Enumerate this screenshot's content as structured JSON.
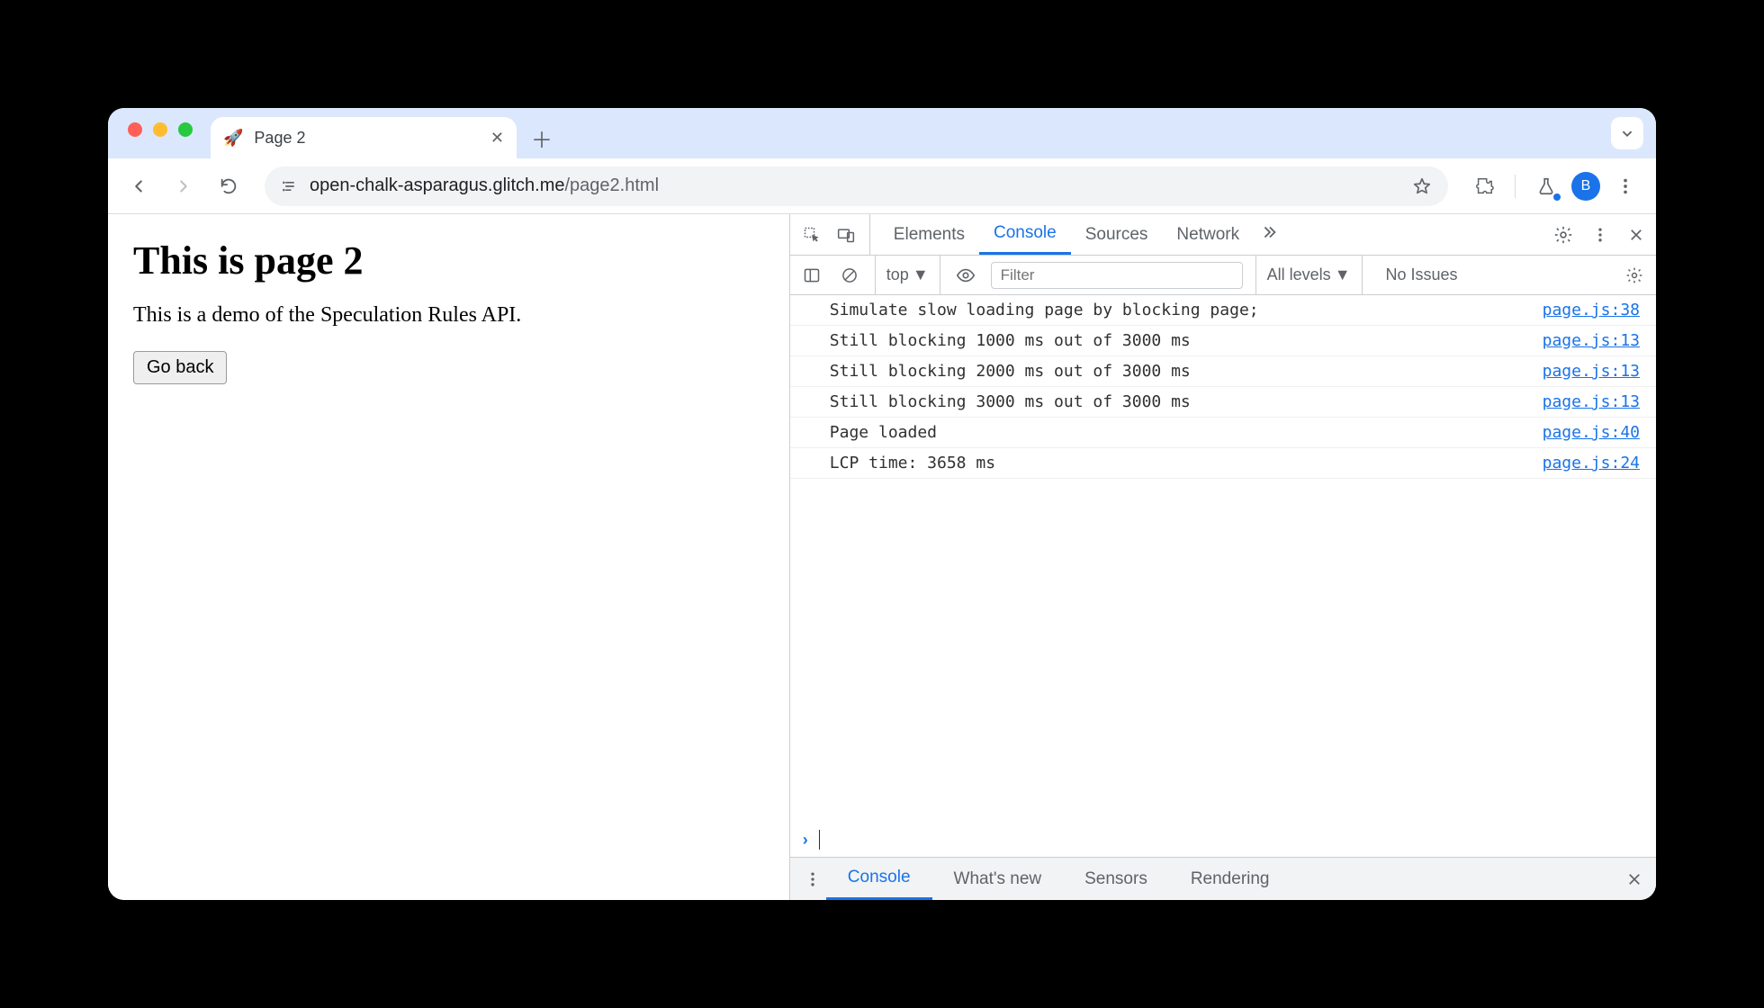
{
  "browser": {
    "tab_favicon": "🚀",
    "tab_title": "Page 2",
    "url_host": "open-chalk-asparagus.glitch.me",
    "url_path": "/page2.html",
    "avatar_letter": "B"
  },
  "page": {
    "heading": "This is page 2",
    "description": "This is a demo of the Speculation Rules API.",
    "back_button": "Go back"
  },
  "devtools": {
    "tabs": {
      "elements": "Elements",
      "console": "Console",
      "sources": "Sources",
      "network": "Network"
    },
    "context_label": "top",
    "filter_placeholder": "Filter",
    "levels_label": "All levels",
    "no_issues": "No Issues",
    "logs": [
      {
        "msg": "Simulate slow loading page by blocking page;",
        "src": "page.js:38"
      },
      {
        "msg": "Still blocking 1000 ms out of 3000 ms",
        "src": "page.js:13"
      },
      {
        "msg": "Still blocking 2000 ms out of 3000 ms",
        "src": "page.js:13"
      },
      {
        "msg": "Still blocking 3000 ms out of 3000 ms",
        "src": "page.js:13"
      },
      {
        "msg": "Page loaded",
        "src": "page.js:40"
      },
      {
        "msg": "LCP time: 3658 ms",
        "src": "page.js:24"
      }
    ],
    "drawer": {
      "console": "Console",
      "whatsnew": "What's new",
      "sensors": "Sensors",
      "rendering": "Rendering"
    }
  }
}
